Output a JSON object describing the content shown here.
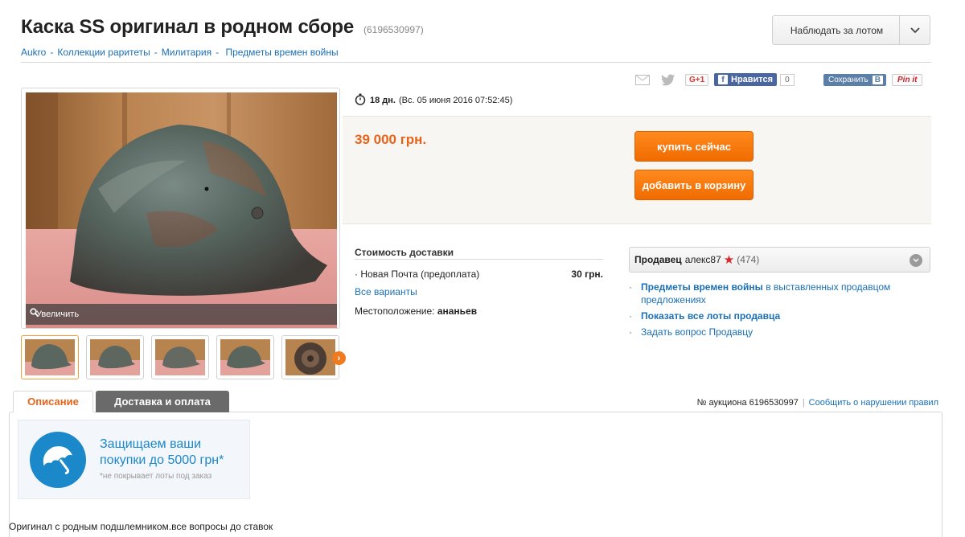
{
  "header": {
    "title": "Каска SS оригинал в родном сборе",
    "lot_id": "(6196530997)",
    "watch_button": "Наблюдать за лотом",
    "breadcrumb": [
      "Aukro",
      "Коллекции раритеты",
      "Милитария",
      "Предметы времен войны"
    ]
  },
  "social": {
    "gplus": "G+1",
    "facebook_like": "Нравится",
    "facebook_count": "0",
    "vk_save": "Сохранить",
    "vk_badge": "В",
    "pinterest": "Pin it"
  },
  "gallery": {
    "zoom_label": "Увеличить",
    "thumbnail_count": 5
  },
  "time": {
    "remaining": "18 дн.",
    "end_date": "(Вс. 05 июня 2016 07:52:45)"
  },
  "price": {
    "value": "39 000 грн.",
    "buy_now": "купить сейчас",
    "add_to_cart": "добавить в корзину"
  },
  "delivery": {
    "title": "Стоимость доставки",
    "method": "Новая Почта (предоплата)",
    "method_price": "30 грн.",
    "all_variants": "Все варианты",
    "location_label": "Местоположение:",
    "location_value": "ананьев"
  },
  "seller": {
    "label": "Продавец",
    "name": "алекс87",
    "rating": "(474)",
    "link1_strong": "Предметы времен войны",
    "link1_rest": " в выставленных продавцом предложениях",
    "link2": "Показать все лоты продавца",
    "link3": "Задать вопрос Продавцу"
  },
  "tabs": {
    "description": "Описание",
    "shipping": "Доставка и оплата"
  },
  "auction": {
    "number": "№ аукциона 6196530997",
    "report": "Сообщить о нарушении правил"
  },
  "promo": {
    "line1": "Защищаем ваши",
    "line2": "покупки до 5000 грн*",
    "note": "*не покрывает лоты под заказ"
  },
  "description_text": "Оригинал с родным подшлемником.все вопросы до ставок",
  "colors": {
    "accent_orange": "#f06b00",
    "link_blue": "#1a6fb5",
    "promo_blue": "#1a88c9"
  }
}
